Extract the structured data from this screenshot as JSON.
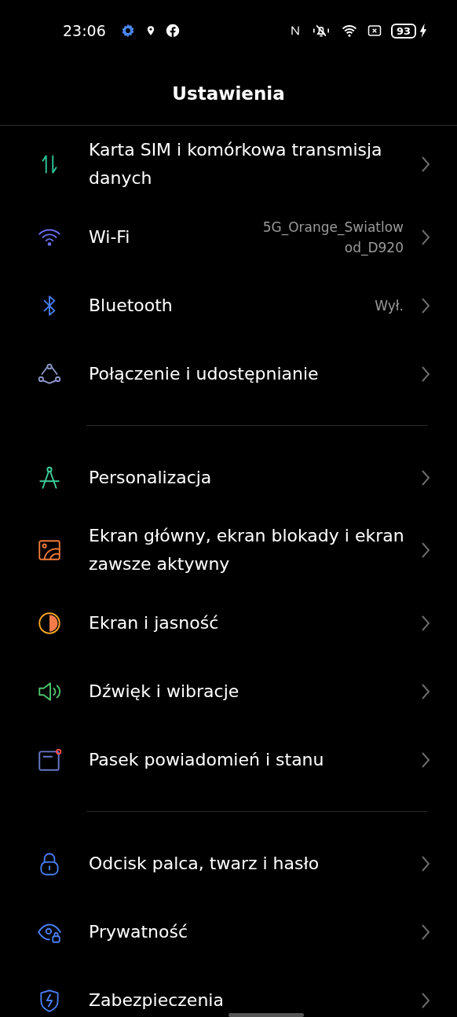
{
  "status_bar": {
    "time": "23:06",
    "battery": "93"
  },
  "title": "Ustawienia",
  "sections": [
    {
      "items": [
        {
          "kind": "sim",
          "label": "Karta SIM i komórkowa transmisja danych"
        },
        {
          "kind": "wifi",
          "label": "Wi-Fi",
          "value": "5G_Orange_Swiatlow od_D920"
        },
        {
          "kind": "bluetooth",
          "label": "Bluetooth",
          "value": "Wył."
        },
        {
          "kind": "connection",
          "label": "Połączenie i udostępnianie"
        }
      ]
    },
    {
      "items": [
        {
          "kind": "personalize",
          "label": "Personalizacja"
        },
        {
          "kind": "wallpaper",
          "label": "Ekran główny, ekran blokady i ekran zawsze aktywny"
        },
        {
          "kind": "display",
          "label": "Ekran i jasność"
        },
        {
          "kind": "sound",
          "label": "Dźwięk i wibracje"
        },
        {
          "kind": "notification",
          "label": "Pasek powiadomień i stanu"
        }
      ]
    },
    {
      "items": [
        {
          "kind": "lock",
          "label": "Odcisk palca, twarz i hasło"
        },
        {
          "kind": "privacy",
          "label": "Prywatność"
        },
        {
          "kind": "security",
          "label": "Zabezpieczenia"
        }
      ]
    }
  ]
}
